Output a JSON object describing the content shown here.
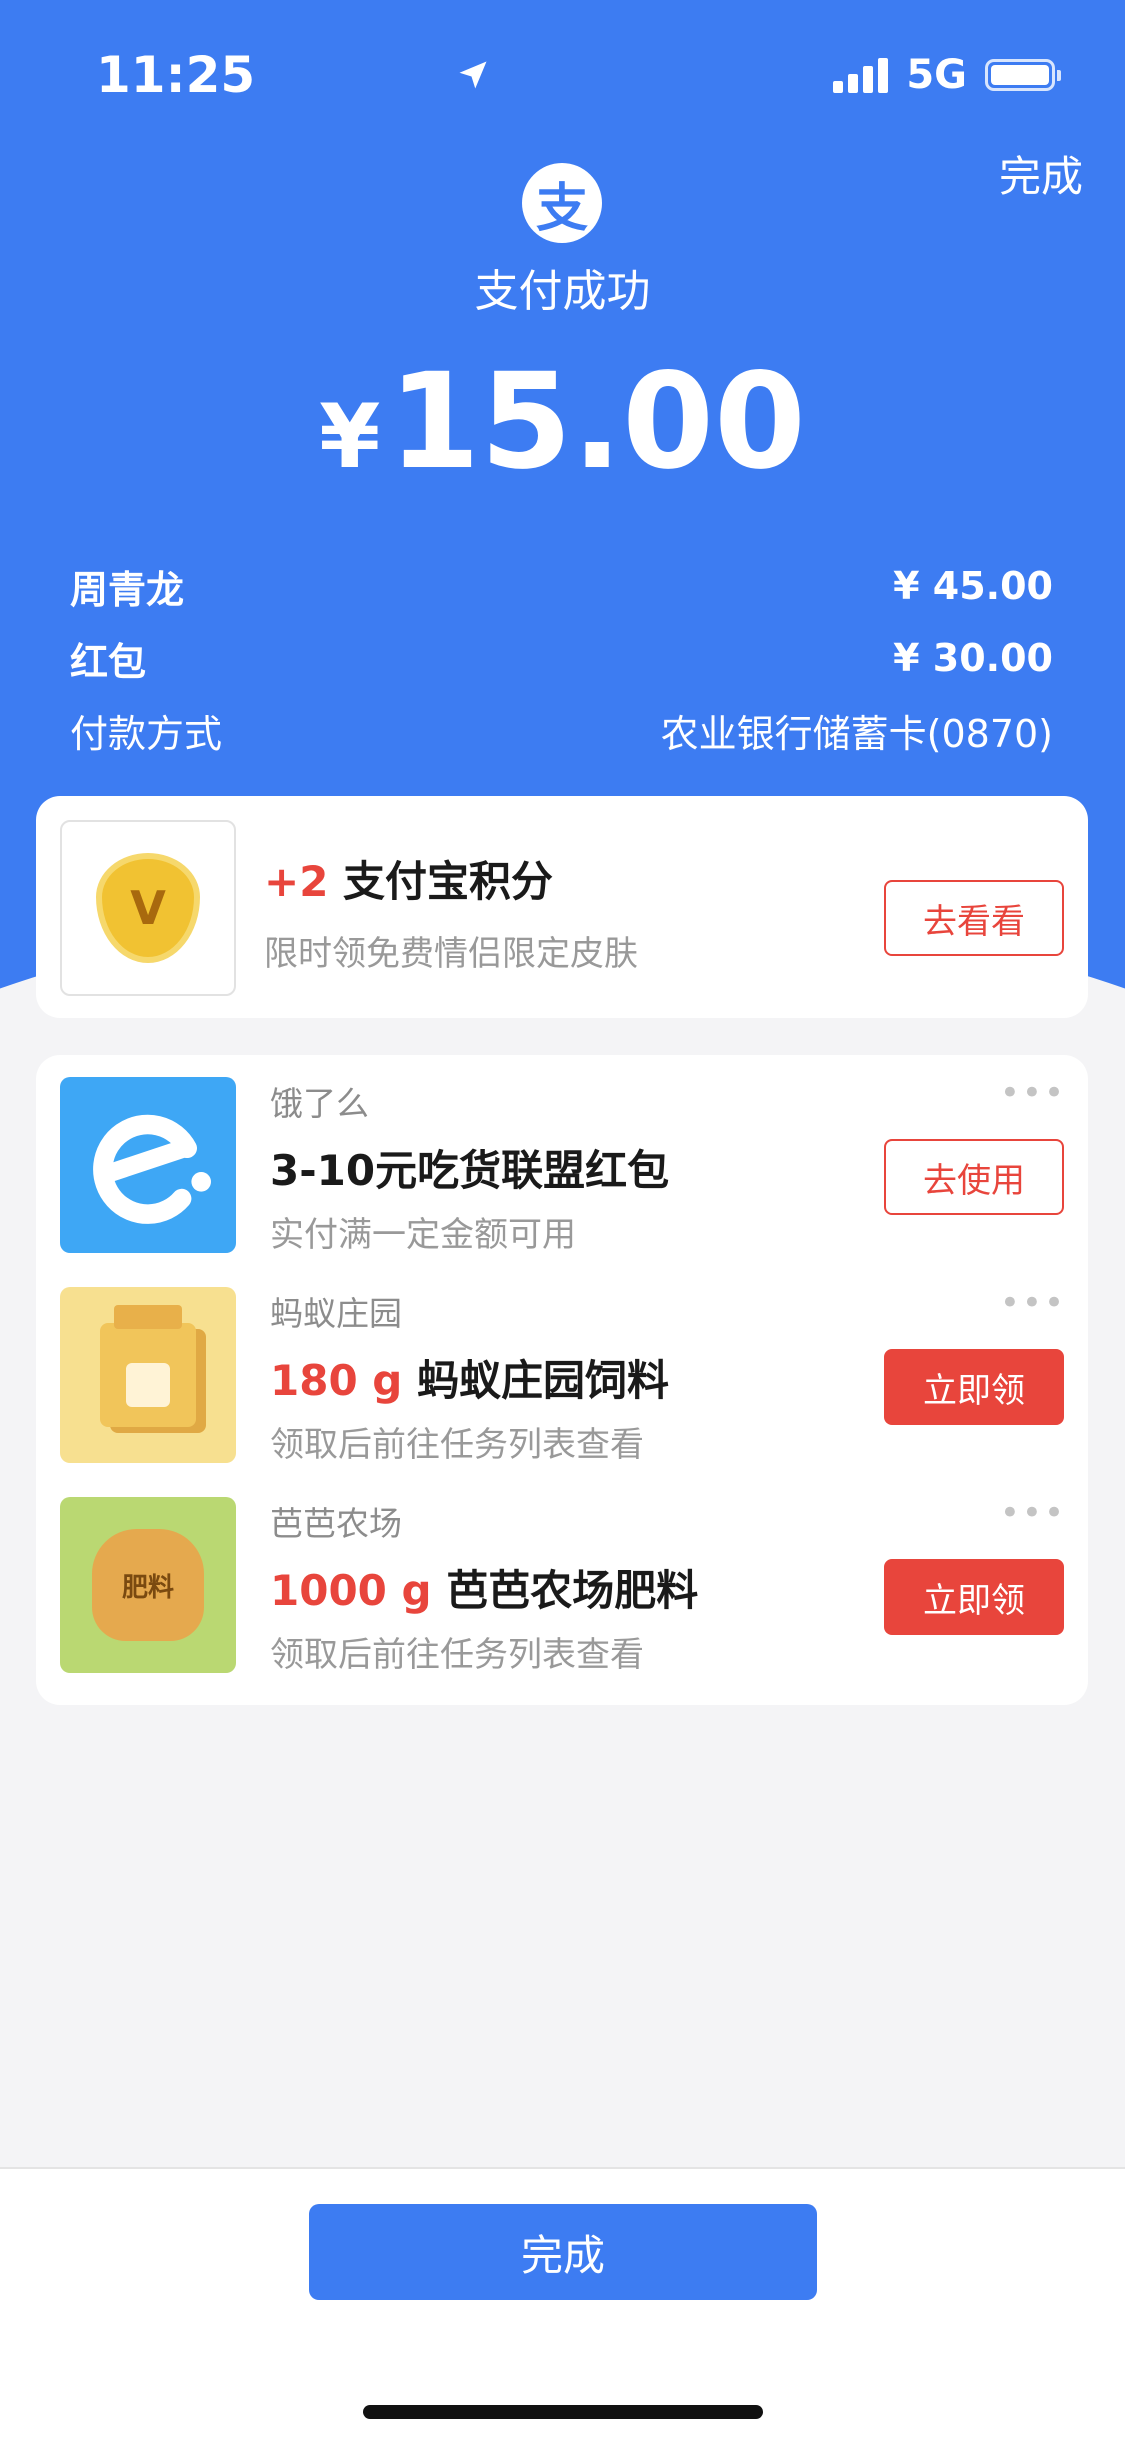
{
  "status": {
    "time": "11:25",
    "network": "5G"
  },
  "header": {
    "done_label": "完成",
    "logo_glyph": "支",
    "title": "支付成功",
    "currency": "¥",
    "amount": "15.00"
  },
  "details": [
    {
      "label": "周青龙",
      "value": "¥ 45.00"
    },
    {
      "label": "红包",
      "value": "¥ 30.00"
    },
    {
      "label": "付款方式",
      "value": "农业银行储蓄卡(0870)"
    }
  ],
  "points": {
    "coin_glyph": "V",
    "bonus": "+2",
    "title": "支付宝积分",
    "subtitle": "限时领免费情侣限定皮肤",
    "button": "去看看"
  },
  "coupons": [
    {
      "brand": "饿了么",
      "highlight": "",
      "title": "3-10元吃货联盟红包",
      "subtitle": "实付满一定金额可用",
      "button": "去使用",
      "style": "outline"
    },
    {
      "brand": "蚂蚁庄园",
      "highlight": "180 g",
      "title": "蚂蚁庄园饲料",
      "subtitle": "领取后前往任务列表查看",
      "button": "立即领",
      "style": "solid"
    },
    {
      "brand": "芭芭农场",
      "highlight": "1000 g",
      "title": "芭芭农场肥料",
      "subtitle": "领取后前往任务列表查看",
      "button": "立即领",
      "style": "solid",
      "sack_label": "肥料"
    }
  ],
  "more_glyph": "•••",
  "footer": {
    "done_label": "完成"
  },
  "colors": {
    "primary": "#3d7cf2",
    "accent_red": "#e8453c",
    "background": "#f4f4f6"
  }
}
